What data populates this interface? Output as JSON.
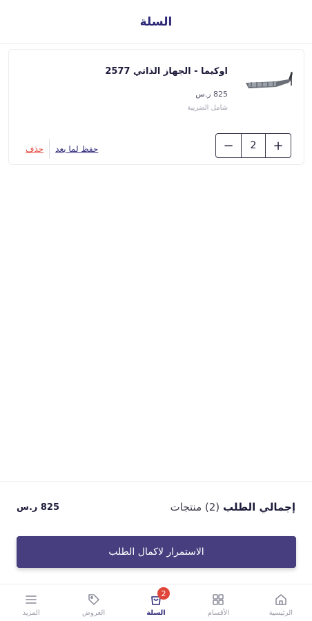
{
  "header": {
    "title": "السلة"
  },
  "cart_item": {
    "name": "اوكيما -  الجهاز الذاتي 2577",
    "price": "825 ر.س",
    "tax_note": "شامل الضريبة",
    "quantity": "2",
    "plus_symbol": "+",
    "minus_symbol": "−",
    "save_later_label": "حفظ لما بعد",
    "delete_label": "حذف",
    "image_icon": "fishing-reel-rod-image"
  },
  "summary": {
    "total_label": "إجمالي الطلب",
    "count_label": "(2) منتجات",
    "amount": "825 ر.س"
  },
  "checkout": {
    "label": "الاستمرار لاكمال الطلب"
  },
  "bottom_nav": {
    "items": [
      {
        "label": "الرئيسية",
        "icon": "home-icon"
      },
      {
        "label": "الأقسام",
        "icon": "grid-icon"
      },
      {
        "label": "السلة",
        "icon": "cart-icon",
        "badge": "2"
      },
      {
        "label": "العروض",
        "icon": "tag-icon"
      },
      {
        "label": "المزيد",
        "icon": "menu-icon"
      }
    ]
  },
  "colors": {
    "accent": "#463e7e",
    "title": "#2f2a78",
    "danger": "#e0463a"
  }
}
